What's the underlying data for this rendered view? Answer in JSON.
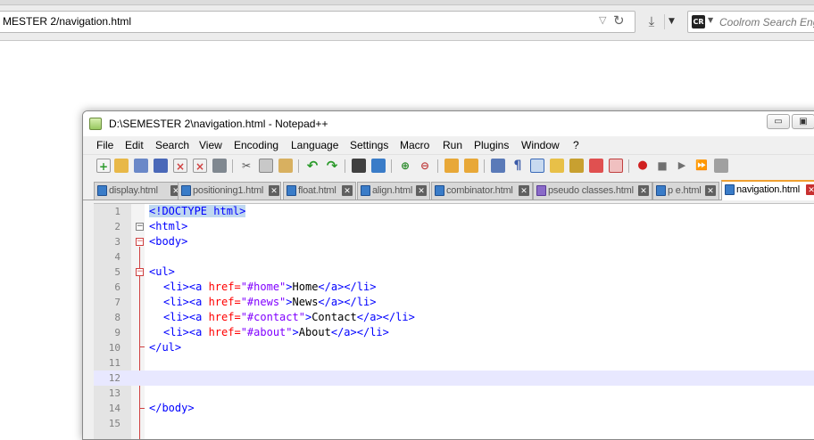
{
  "browser": {
    "url": "MESTER 2/navigation.html",
    "search_placeholder": "Coolrom Search Engi",
    "search_logo": "CR"
  },
  "npp": {
    "title": "D:\\SEMESTER 2\\navigation.html - Notepad++",
    "menu": [
      "File",
      "Edit",
      "Search",
      "View",
      "Encoding",
      "Language",
      "Settings",
      "Macro",
      "Run",
      "Plugins",
      "Window",
      "?"
    ],
    "tabs": [
      {
        "label": "display.html",
        "active": false
      },
      {
        "label": "positioning1.html",
        "active": false
      },
      {
        "label": "float.html",
        "active": false
      },
      {
        "label": "align.html",
        "active": false
      },
      {
        "label": "combinator.html",
        "active": false
      },
      {
        "label": "pseudo classes.html",
        "active": false
      },
      {
        "label": "p e.html",
        "active": false
      },
      {
        "label": "navigation.html",
        "active": true
      }
    ],
    "line_numbers": [
      "1",
      "2",
      "3",
      "4",
      "5",
      "6",
      "7",
      "8",
      "9",
      "10",
      "11",
      "12",
      "13",
      "14",
      "15"
    ],
    "code": {
      "l1": "<!DOCTYPE html>",
      "l2": "<html>",
      "l3": "<body>",
      "l5": "<ul>",
      "li_open": "<li><a ",
      "href": "href=",
      "close_tag": ">",
      "end_a": "</a></li>",
      "l6_val": "\"#home\"",
      "l6_text": "Home",
      "l7_val": "\"#news\"",
      "l7_text": "News",
      "l8_val": "\"#contact\"",
      "l8_text": "Contact",
      "l9_val": "\"#about\"",
      "l9_text": "About",
      "l10": "</ul>",
      "l14": "</body>"
    },
    "colors": {
      "tag": "#0000ff",
      "attribute": "#ff0000",
      "string": "#8000ff",
      "current_line": "#e8e8ff"
    }
  }
}
